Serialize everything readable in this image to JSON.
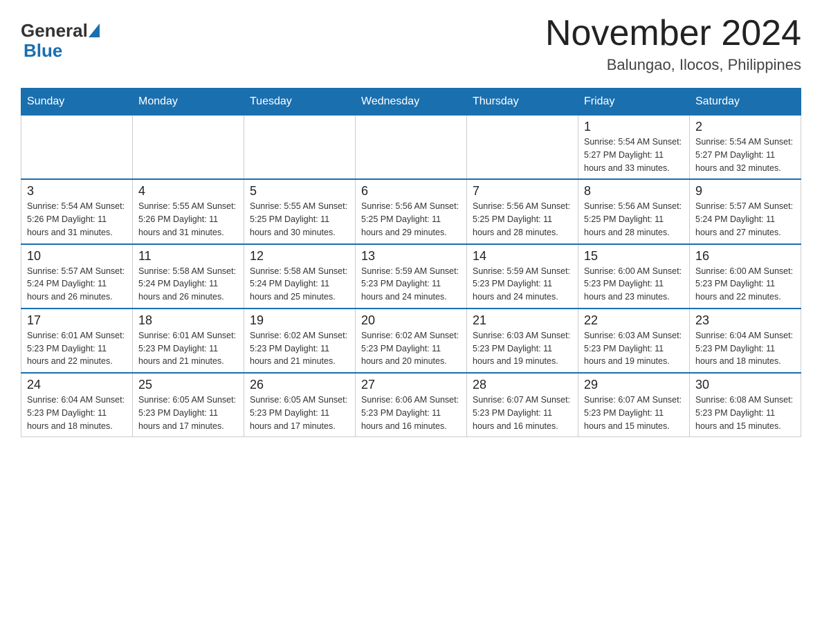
{
  "header": {
    "logo_general": "General",
    "logo_blue": "Blue",
    "title": "November 2024",
    "subtitle": "Balungao, Ilocos, Philippines"
  },
  "days_of_week": [
    "Sunday",
    "Monday",
    "Tuesday",
    "Wednesday",
    "Thursday",
    "Friday",
    "Saturday"
  ],
  "weeks": [
    {
      "days": [
        {
          "num": "",
          "info": ""
        },
        {
          "num": "",
          "info": ""
        },
        {
          "num": "",
          "info": ""
        },
        {
          "num": "",
          "info": ""
        },
        {
          "num": "",
          "info": ""
        },
        {
          "num": "1",
          "info": "Sunrise: 5:54 AM\nSunset: 5:27 PM\nDaylight: 11 hours and 33 minutes."
        },
        {
          "num": "2",
          "info": "Sunrise: 5:54 AM\nSunset: 5:27 PM\nDaylight: 11 hours and 32 minutes."
        }
      ]
    },
    {
      "days": [
        {
          "num": "3",
          "info": "Sunrise: 5:54 AM\nSunset: 5:26 PM\nDaylight: 11 hours and 31 minutes."
        },
        {
          "num": "4",
          "info": "Sunrise: 5:55 AM\nSunset: 5:26 PM\nDaylight: 11 hours and 31 minutes."
        },
        {
          "num": "5",
          "info": "Sunrise: 5:55 AM\nSunset: 5:25 PM\nDaylight: 11 hours and 30 minutes."
        },
        {
          "num": "6",
          "info": "Sunrise: 5:56 AM\nSunset: 5:25 PM\nDaylight: 11 hours and 29 minutes."
        },
        {
          "num": "7",
          "info": "Sunrise: 5:56 AM\nSunset: 5:25 PM\nDaylight: 11 hours and 28 minutes."
        },
        {
          "num": "8",
          "info": "Sunrise: 5:56 AM\nSunset: 5:25 PM\nDaylight: 11 hours and 28 minutes."
        },
        {
          "num": "9",
          "info": "Sunrise: 5:57 AM\nSunset: 5:24 PM\nDaylight: 11 hours and 27 minutes."
        }
      ]
    },
    {
      "days": [
        {
          "num": "10",
          "info": "Sunrise: 5:57 AM\nSunset: 5:24 PM\nDaylight: 11 hours and 26 minutes."
        },
        {
          "num": "11",
          "info": "Sunrise: 5:58 AM\nSunset: 5:24 PM\nDaylight: 11 hours and 26 minutes."
        },
        {
          "num": "12",
          "info": "Sunrise: 5:58 AM\nSunset: 5:24 PM\nDaylight: 11 hours and 25 minutes."
        },
        {
          "num": "13",
          "info": "Sunrise: 5:59 AM\nSunset: 5:23 PM\nDaylight: 11 hours and 24 minutes."
        },
        {
          "num": "14",
          "info": "Sunrise: 5:59 AM\nSunset: 5:23 PM\nDaylight: 11 hours and 24 minutes."
        },
        {
          "num": "15",
          "info": "Sunrise: 6:00 AM\nSunset: 5:23 PM\nDaylight: 11 hours and 23 minutes."
        },
        {
          "num": "16",
          "info": "Sunrise: 6:00 AM\nSunset: 5:23 PM\nDaylight: 11 hours and 22 minutes."
        }
      ]
    },
    {
      "days": [
        {
          "num": "17",
          "info": "Sunrise: 6:01 AM\nSunset: 5:23 PM\nDaylight: 11 hours and 22 minutes."
        },
        {
          "num": "18",
          "info": "Sunrise: 6:01 AM\nSunset: 5:23 PM\nDaylight: 11 hours and 21 minutes."
        },
        {
          "num": "19",
          "info": "Sunrise: 6:02 AM\nSunset: 5:23 PM\nDaylight: 11 hours and 21 minutes."
        },
        {
          "num": "20",
          "info": "Sunrise: 6:02 AM\nSunset: 5:23 PM\nDaylight: 11 hours and 20 minutes."
        },
        {
          "num": "21",
          "info": "Sunrise: 6:03 AM\nSunset: 5:23 PM\nDaylight: 11 hours and 19 minutes."
        },
        {
          "num": "22",
          "info": "Sunrise: 6:03 AM\nSunset: 5:23 PM\nDaylight: 11 hours and 19 minutes."
        },
        {
          "num": "23",
          "info": "Sunrise: 6:04 AM\nSunset: 5:23 PM\nDaylight: 11 hours and 18 minutes."
        }
      ]
    },
    {
      "days": [
        {
          "num": "24",
          "info": "Sunrise: 6:04 AM\nSunset: 5:23 PM\nDaylight: 11 hours and 18 minutes."
        },
        {
          "num": "25",
          "info": "Sunrise: 6:05 AM\nSunset: 5:23 PM\nDaylight: 11 hours and 17 minutes."
        },
        {
          "num": "26",
          "info": "Sunrise: 6:05 AM\nSunset: 5:23 PM\nDaylight: 11 hours and 17 minutes."
        },
        {
          "num": "27",
          "info": "Sunrise: 6:06 AM\nSunset: 5:23 PM\nDaylight: 11 hours and 16 minutes."
        },
        {
          "num": "28",
          "info": "Sunrise: 6:07 AM\nSunset: 5:23 PM\nDaylight: 11 hours and 16 minutes."
        },
        {
          "num": "29",
          "info": "Sunrise: 6:07 AM\nSunset: 5:23 PM\nDaylight: 11 hours and 15 minutes."
        },
        {
          "num": "30",
          "info": "Sunrise: 6:08 AM\nSunset: 5:23 PM\nDaylight: 11 hours and 15 minutes."
        }
      ]
    }
  ]
}
